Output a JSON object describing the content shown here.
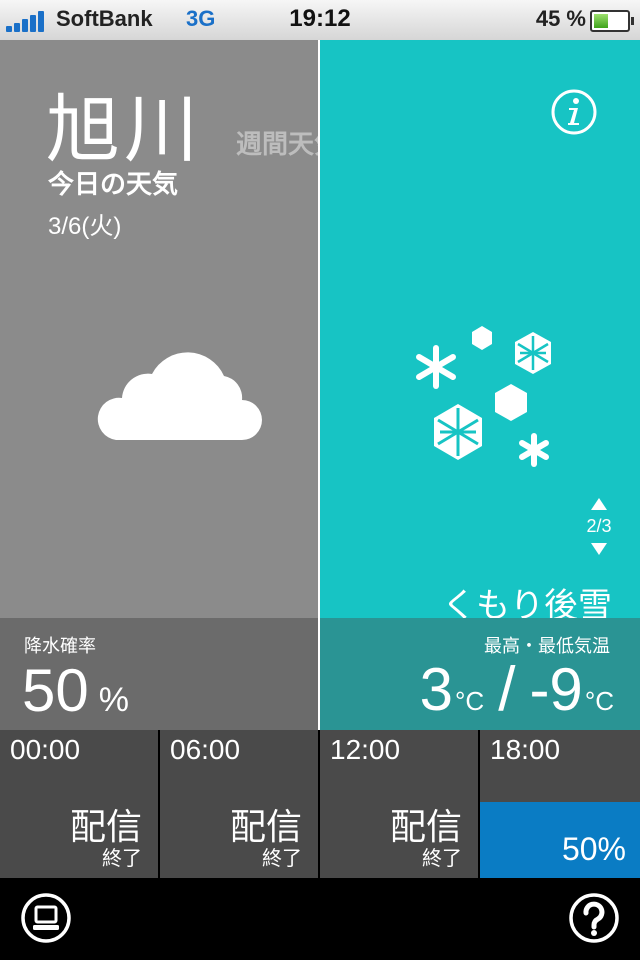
{
  "status_bar": {
    "carrier": "SoftBank",
    "network": "3G",
    "time": "19:12",
    "battery_percent": "45 %",
    "battery_level": 0.45,
    "signal_icon": "signal-bars-icon"
  },
  "header": {
    "city": "旭川",
    "tab_today": "今日の天気",
    "tab_weekly": "週間天気",
    "date": "3/6(火)"
  },
  "forecast": {
    "morning_icon": "cloud-icon",
    "evening_icon": "snow-icon",
    "condition": "くもり後雪",
    "page_indicator": "2/3"
  },
  "precipitation": {
    "label": "降水確率",
    "value": "50",
    "unit": "%"
  },
  "temperature": {
    "label": "最高・最低気温",
    "high": "3",
    "low": "-9",
    "unit": "°C",
    "separator": "/"
  },
  "hourly": [
    {
      "time": "00:00",
      "main": "配信",
      "sub": "終了"
    },
    {
      "time": "06:00",
      "main": "配信",
      "sub": "終了"
    },
    {
      "time": "12:00",
      "main": "配信",
      "sub": "終了"
    },
    {
      "time": "18:00",
      "percent": "50%"
    }
  ],
  "colors": {
    "left_panel": "#8b8b8b",
    "right_panel": "#17c4c4",
    "precip_bar": "#0a7cc4"
  }
}
